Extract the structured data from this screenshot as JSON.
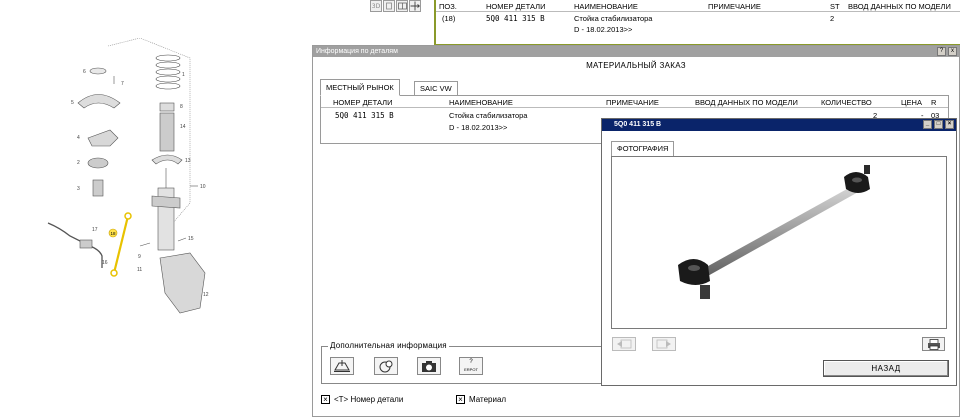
{
  "toolbar": {
    "buttons": [
      {
        "label": "3D",
        "icon": "3d-icon"
      },
      {
        "label": "",
        "icon": "page-icon"
      },
      {
        "label": "",
        "icon": "split-view-icon"
      },
      {
        "label": "",
        "icon": "move-arrows-icon"
      }
    ]
  },
  "top_table": {
    "headers": {
      "pos": "ПОЗ.",
      "part_no": "НОМЕР ДЕТАЛИ",
      "name": "НАИМЕНОВАНИЕ",
      "note": "ПРИМЕЧАНИЕ",
      "st": "ST",
      "model_input": "ВВОД ДАННЫХ ПО МОДЕЛИ"
    },
    "row": {
      "pos": "(18)",
      "part_no": "5Q0 411 315 B",
      "name": "Стойка стабилизатора",
      "date": "D - 18.02.2013>>",
      "st": "2"
    }
  },
  "diagram": {
    "callouts": [
      "1",
      "2",
      "3",
      "4",
      "5",
      "6",
      "7",
      "8",
      "9",
      "10",
      "11",
      "12",
      "13",
      "14",
      "15",
      "16",
      "17",
      "18"
    ],
    "highlight": "18"
  },
  "info_window": {
    "title": "Информация по деталям",
    "help": "?",
    "close": "x",
    "material_title": "МАТЕРИАЛЬНЫЙ ЗАКАЗ",
    "tabs": [
      "МЕСТНЫЙ РЫНОК",
      "SAIC VW"
    ],
    "table": {
      "headers": {
        "part_no": "НОМЕР ДЕТАЛИ",
        "name": "НАИМЕНОВАНИЕ",
        "note": "ПРИМЕЧАНИЕ",
        "model_input": "ВВОД ДАННЫХ ПО МОДЕЛИ",
        "qty": "КОЛИЧЕСТВО",
        "price": "ЦЕНА",
        "r": "R"
      },
      "row": {
        "part_no": "5Q0 411 315 B",
        "name": "Стойка стабилизатора",
        "date": "D - 18.02.2013>>",
        "qty": "2",
        "price": "-",
        "r": "03"
      }
    },
    "additional_info": {
      "label": "Дополнительная информация",
      "buttons": [
        {
          "name": "vehicle-lift-icon",
          "text": ""
        },
        {
          "name": "part-search-icon",
          "text": ""
        },
        {
          "name": "camera-icon",
          "text": ""
        },
        {
          "name": "help-book-icon",
          "text": "?"
        }
      ],
      "help_caption": "ERPOT"
    },
    "checkboxes": [
      {
        "label": "<T> Номер детали",
        "checked": true
      },
      {
        "label": "Материал",
        "checked": true
      }
    ]
  },
  "photo_window": {
    "title": "5Q0 411 315 B",
    "tab": "ФОТОГРАФИЯ",
    "back_label": "НАЗАД"
  },
  "colors": {
    "top_table_border": "#8a9a2a",
    "photo_titlebar": "#0a246a",
    "info_titlebar": "#a0a0a0",
    "highlight_part": "#e8c200"
  }
}
